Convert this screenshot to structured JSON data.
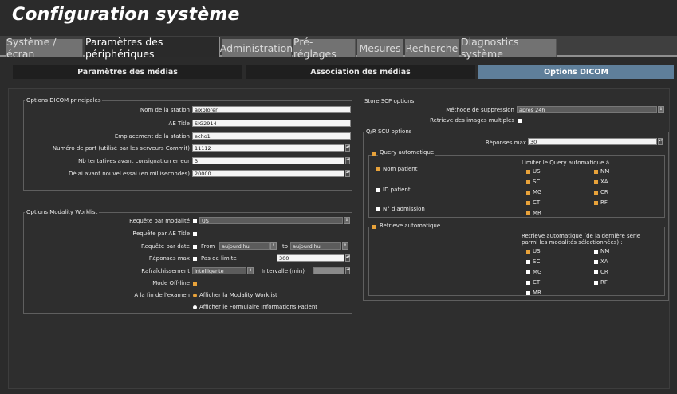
{
  "app_title": "Configuration système",
  "tabs": [
    {
      "label": "Système / écran"
    },
    {
      "label": "Paramètres des périphériques"
    },
    {
      "label": "Administration"
    },
    {
      "label": "Pré-réglages"
    },
    {
      "label": "Mesures"
    },
    {
      "label": "Recherche"
    },
    {
      "label": "Diagnostics système"
    }
  ],
  "subtabs": [
    {
      "label": "Paramètres des médias"
    },
    {
      "label": "Association des médias"
    },
    {
      "label": "Options DICOM"
    }
  ],
  "dicom_main": {
    "title": "Options DICOM principales",
    "station_name_label": "Nom de la station",
    "station_name_value": "aixplorer",
    "ae_title_label": "AE Title",
    "ae_title_value": "SIG2914",
    "location_label": "Emplacement de la station",
    "location_value": "echo1",
    "port_label": "Numéro de port (utilisé par les serveurs Commit)",
    "port_value": "11112",
    "retries_label": "Nb tentatives avant consignation erreur",
    "retries_value": "3",
    "delay_label": "Délai avant nouvel essai (en millisecondes)",
    "delay_value": "20000"
  },
  "worklist": {
    "title": "Options Modality Worklist",
    "by_modality_label": "Requête par modalité",
    "by_modality_value": "US",
    "by_ae_title_label": "Requête par AE Title",
    "by_date_label": "Requête par date",
    "from_label": "From",
    "from_value": "aujourd'hui",
    "to_label": "to",
    "to_value": "aujourd'hui",
    "max_responses_label": "Réponses max",
    "no_limit_label": "Pas de limite",
    "max_responses_value": "300",
    "refresh_label": "Rafraîchissement",
    "refresh_value": "intelligente",
    "interval_label": "Intervalle (min)",
    "offline_label": "Mode Off-line",
    "end_exam_label": "A la fin de l'examen",
    "show_worklist_label": "Afficher la Modality Worklist",
    "show_form_label": "Afficher le Formulaire Informations Patient"
  },
  "store_scp": {
    "title": "Store  SCP options",
    "deletion_label": "Méthode de suppression",
    "deletion_value": "après 24h",
    "multi_retrieve_label": "Retrieve des images multiples"
  },
  "qr_scu": {
    "title": "Q/R SCU options",
    "max_responses_label": "Réponses max",
    "max_responses_value": "30",
    "auto_query_label": "Query automatique",
    "patient_name_label": "Nom patient",
    "patient_id_label": "ID patient",
    "admission_label": "N° d'admission",
    "limit_label": "Limiter le Query automatique à :",
    "modalities": [
      "US",
      "NM",
      "SC",
      "XA",
      "MG",
      "CR",
      "CT",
      "RF",
      "MR"
    ],
    "auto_retrieve_label": "Retrieve automatique",
    "retrieve_desc_line1": "Retrieve automatique (de la dernière série",
    "retrieve_desc_line2": "parmi les modalités sélectionnées) :"
  },
  "colors": {
    "accent_orange": "#e8a23a",
    "active_subtab": "#5f7f9a"
  }
}
